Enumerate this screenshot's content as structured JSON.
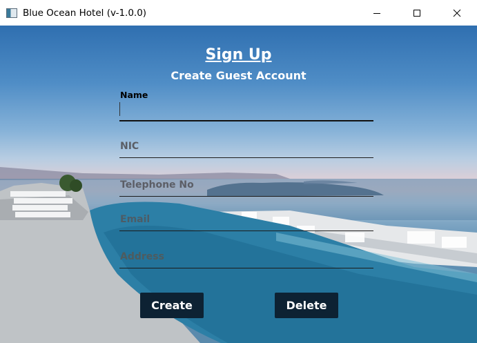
{
  "window": {
    "title": "Blue Ocean Hotel (v-1.0.0)"
  },
  "form": {
    "title": "Sign Up",
    "subtitle": "Create Guest Account",
    "fields": [
      {
        "label": "Name",
        "placeholder": ""
      },
      {
        "label": "",
        "placeholder": "NIC"
      },
      {
        "label": "",
        "placeholder": "Telephone No"
      },
      {
        "label": "",
        "placeholder": "Email"
      },
      {
        "label": "",
        "placeholder": "Address"
      }
    ]
  },
  "buttons": {
    "create": "Create",
    "delete": "Delete"
  },
  "colors": {
    "button_bg": "#0d2233",
    "button_text": "#ffffff",
    "heading": "#ffffff"
  },
  "icons": [
    "app-icon",
    "minimize-icon",
    "maximize-icon",
    "close-icon"
  ]
}
